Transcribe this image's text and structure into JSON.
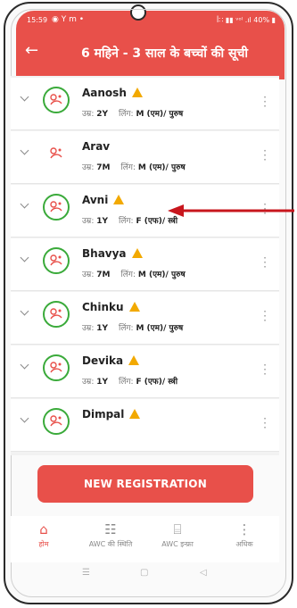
{
  "status_bar": {
    "time": "15:59",
    "icons": "◉ Y m •",
    "right": "ꟾ∷ ▮▮ ᵛᵒˡ .ıl 40% ▮"
  },
  "header": {
    "back_icon": "back-arrow-icon",
    "title": "6 महिने - 3 साल के बच्चों की सूची"
  },
  "children": [
    {
      "name": "Aanosh",
      "age_label": "उम्र:",
      "age": "2Y",
      "gender_label": "लिंग:",
      "gender": "M (एम)/ पुरुष",
      "warning": true,
      "avatar_ring": true
    },
    {
      "name": "Arav",
      "age_label": "उम्र:",
      "age": "7M",
      "gender_label": "लिंग:",
      "gender": "M (एम)/ पुरुष",
      "warning": false,
      "avatar_ring": false
    },
    {
      "name": "Avni",
      "age_label": "उम्र:",
      "age": "1Y",
      "gender_label": "लिंग:",
      "gender": "F (एफ)/ स्त्री",
      "warning": true,
      "avatar_ring": true
    },
    {
      "name": "Bhavya",
      "age_label": "उम्र:",
      "age": "7M",
      "gender_label": "लिंग:",
      "gender": "M (एम)/ पुरुष",
      "warning": true,
      "avatar_ring": true
    },
    {
      "name": "Chinku",
      "age_label": "उम्र:",
      "age": "1Y",
      "gender_label": "लिंग:",
      "gender": "M (एम)/ पुरुष",
      "warning": true,
      "avatar_ring": true
    },
    {
      "name": "Devika",
      "age_label": "उम्र:",
      "age": "1Y",
      "gender_label": "लिंग:",
      "gender": "F (एफ)/ स्त्री",
      "warning": true,
      "avatar_ring": true
    },
    {
      "name": "Dimpal",
      "age_label": "",
      "age": "",
      "gender_label": "",
      "gender": "",
      "warning": true,
      "avatar_ring": true
    }
  ],
  "register_button": "NEW REGISTRATION",
  "bottom_nav": [
    {
      "label": "होम",
      "icon": "home-icon",
      "active": true
    },
    {
      "label": "AWC की स्थिति",
      "icon": "list-status-icon",
      "active": false
    },
    {
      "label": "AWC इन्फ्रा",
      "icon": "building-icon",
      "active": false
    },
    {
      "label": "अधिक",
      "icon": "more-icon",
      "active": false
    }
  ],
  "colors": {
    "accent": "#e8504a",
    "warning": "#f2a900",
    "avatar_ring": "#3aaa3a",
    "annotation_arrow": "#c8161d"
  }
}
